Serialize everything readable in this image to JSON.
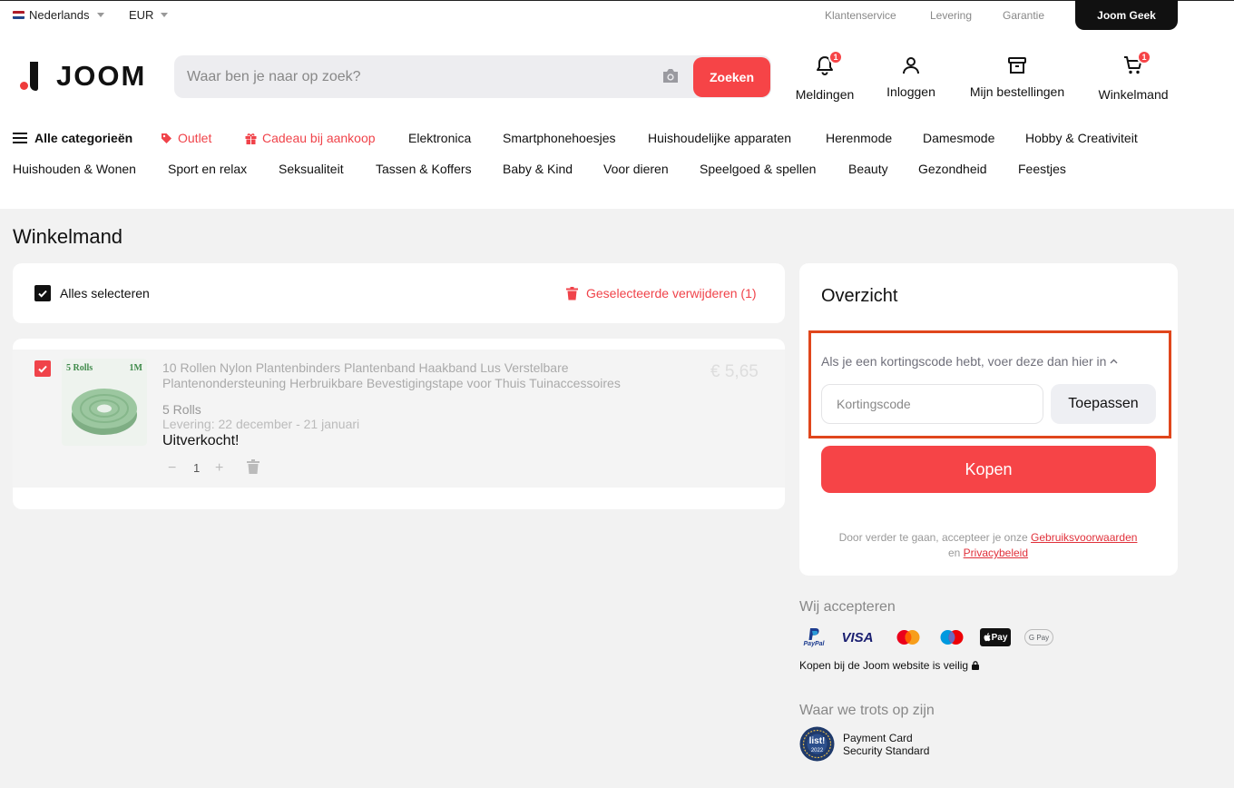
{
  "topbar": {
    "language": "Nederlands",
    "currency": "EUR",
    "links": [
      "Klantenservice",
      "Levering",
      "Garantie"
    ],
    "geek_button": "Joom Geek"
  },
  "logo": {
    "text": "JOOM"
  },
  "search": {
    "placeholder": "Waar ben je naar op zoek?",
    "button": "Zoeken"
  },
  "header_nav": {
    "notifications": {
      "label": "Meldingen",
      "badge": "1"
    },
    "login": {
      "label": "Inloggen"
    },
    "orders": {
      "label": "Mijn bestellingen"
    },
    "cart": {
      "label": "Winkelmand",
      "badge": "1"
    }
  },
  "categories": {
    "all": "Alle categorieën",
    "row1": [
      "Outlet",
      "Cadeau bij aankoop",
      "Elektronica",
      "Smartphonehoesjes",
      "Huishoudelijke apparaten",
      "Herenmode",
      "Damesmode",
      "Hobby & Creativiteit"
    ],
    "row2": [
      "Huishouden & Wonen",
      "Sport en relax",
      "Seksualiteit",
      "Tassen & Koffers",
      "Baby & Kind",
      "Voor dieren",
      "Speelgoed & spellen",
      "Beauty",
      "Gezondheid",
      "Feestjes"
    ]
  },
  "page": {
    "title": "Winkelmand"
  },
  "cart": {
    "select_all": "Alles selecteren",
    "delete_selected": "Geselecteerde verwijderen (1)",
    "item": {
      "image_text_left": "5 Rolls",
      "image_text_right": "1M",
      "title_line1": "10 Rollen Nylon Plantenbinders Plantenband Haakband Lus Verstelbare",
      "title_line2": "Plantenondersteuning Herbruikbare Bevestigingstape voor Thuis Tuinaccessoires",
      "price": "€ 5,65",
      "variant": "5 Rolls",
      "delivery": "Levering: 22 december - 21 januari",
      "status": "Uitverkocht!",
      "quantity": "1",
      "minus": "−",
      "plus": "+"
    }
  },
  "summary": {
    "title": "Overzicht",
    "coupon_prompt": "Als je een kortingscode hebt, voer deze dan hier in",
    "coupon_placeholder": "Kortingscode",
    "apply": "Toepassen",
    "buy": "Kopen",
    "terms_prefix": "Door verder te gaan, accepteer je onze",
    "terms_link": "Gebruiksvoorwaarden",
    "terms_and": "en",
    "privacy_link": "Privacybeleid"
  },
  "payments": {
    "title": "Wij accepteren",
    "paypal": "PayPal",
    "visa": "VISA",
    "applepay": "Pay",
    "gpay": "G Pay",
    "secure_text": "Kopen bij de Joom website is veilig"
  },
  "proud": {
    "title": "Waar we trots op zijn",
    "badge_text": "list!",
    "badge_year": "2022",
    "line1": "Payment Card",
    "line2": "Security Standard"
  },
  "colors": {
    "accent": "#f64447",
    "highlight_border": "#e0461c",
    "background": "#f2f2f2"
  }
}
